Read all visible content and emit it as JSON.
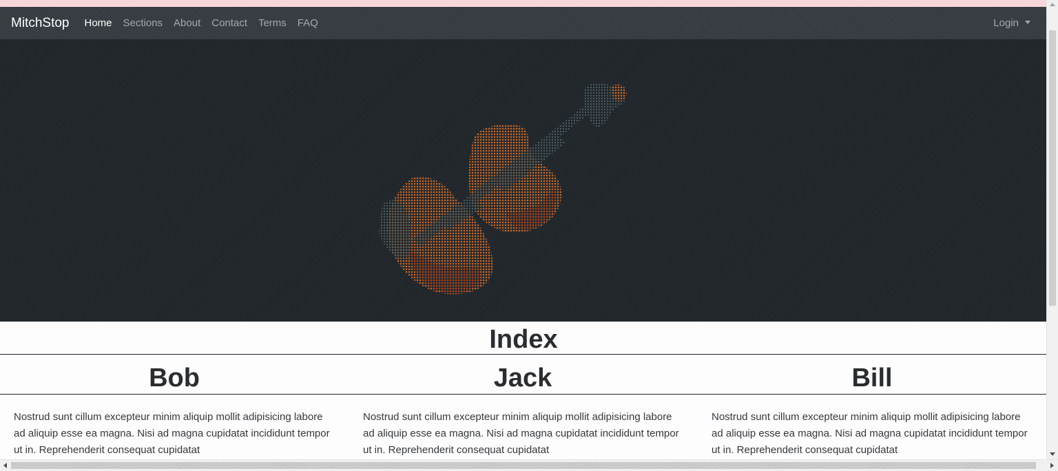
{
  "navbar": {
    "brand": "MitchStop",
    "links": [
      {
        "label": "Home",
        "active": true
      },
      {
        "label": "Sections",
        "active": false
      },
      {
        "label": "About",
        "active": false
      },
      {
        "label": "Contact",
        "active": false
      },
      {
        "label": "Terms",
        "active": false
      },
      {
        "label": "FAQ",
        "active": false
      }
    ],
    "login_label": "Login"
  },
  "hero": {
    "image": "violin-dotted-image"
  },
  "main": {
    "title": "Index",
    "columns": [
      {
        "name": "Bob",
        "text": "Nostrud sunt cillum excepteur minim aliquip mollit adipisicing labore ad aliquip esse ea magna. Nisi ad magna cupidatat incididunt tempor ut in. Reprehenderit consequat cupidatat"
      },
      {
        "name": "Jack",
        "text": "Nostrud sunt cillum excepteur minim aliquip mollit adipisicing labore ad aliquip esse ea magna. Nisi ad magna cupidatat incididunt tempor ut in. Reprehenderit consequat cupidatat"
      },
      {
        "name": "Bill",
        "text": "Nostrud sunt cillum excepteur minim aliquip mollit adipisicing labore ad aliquip esse ea magna. Nisi ad magna cupidatat incididunt tempor ut in. Reprehenderit consequat cupidatat"
      }
    ]
  },
  "colors": {
    "navbar_bg": "#343a40",
    "hero_bg": "#21262b",
    "violin_body": "#c4561c",
    "violin_dark": "#3d5256",
    "top_strip": "#f8d7db"
  }
}
